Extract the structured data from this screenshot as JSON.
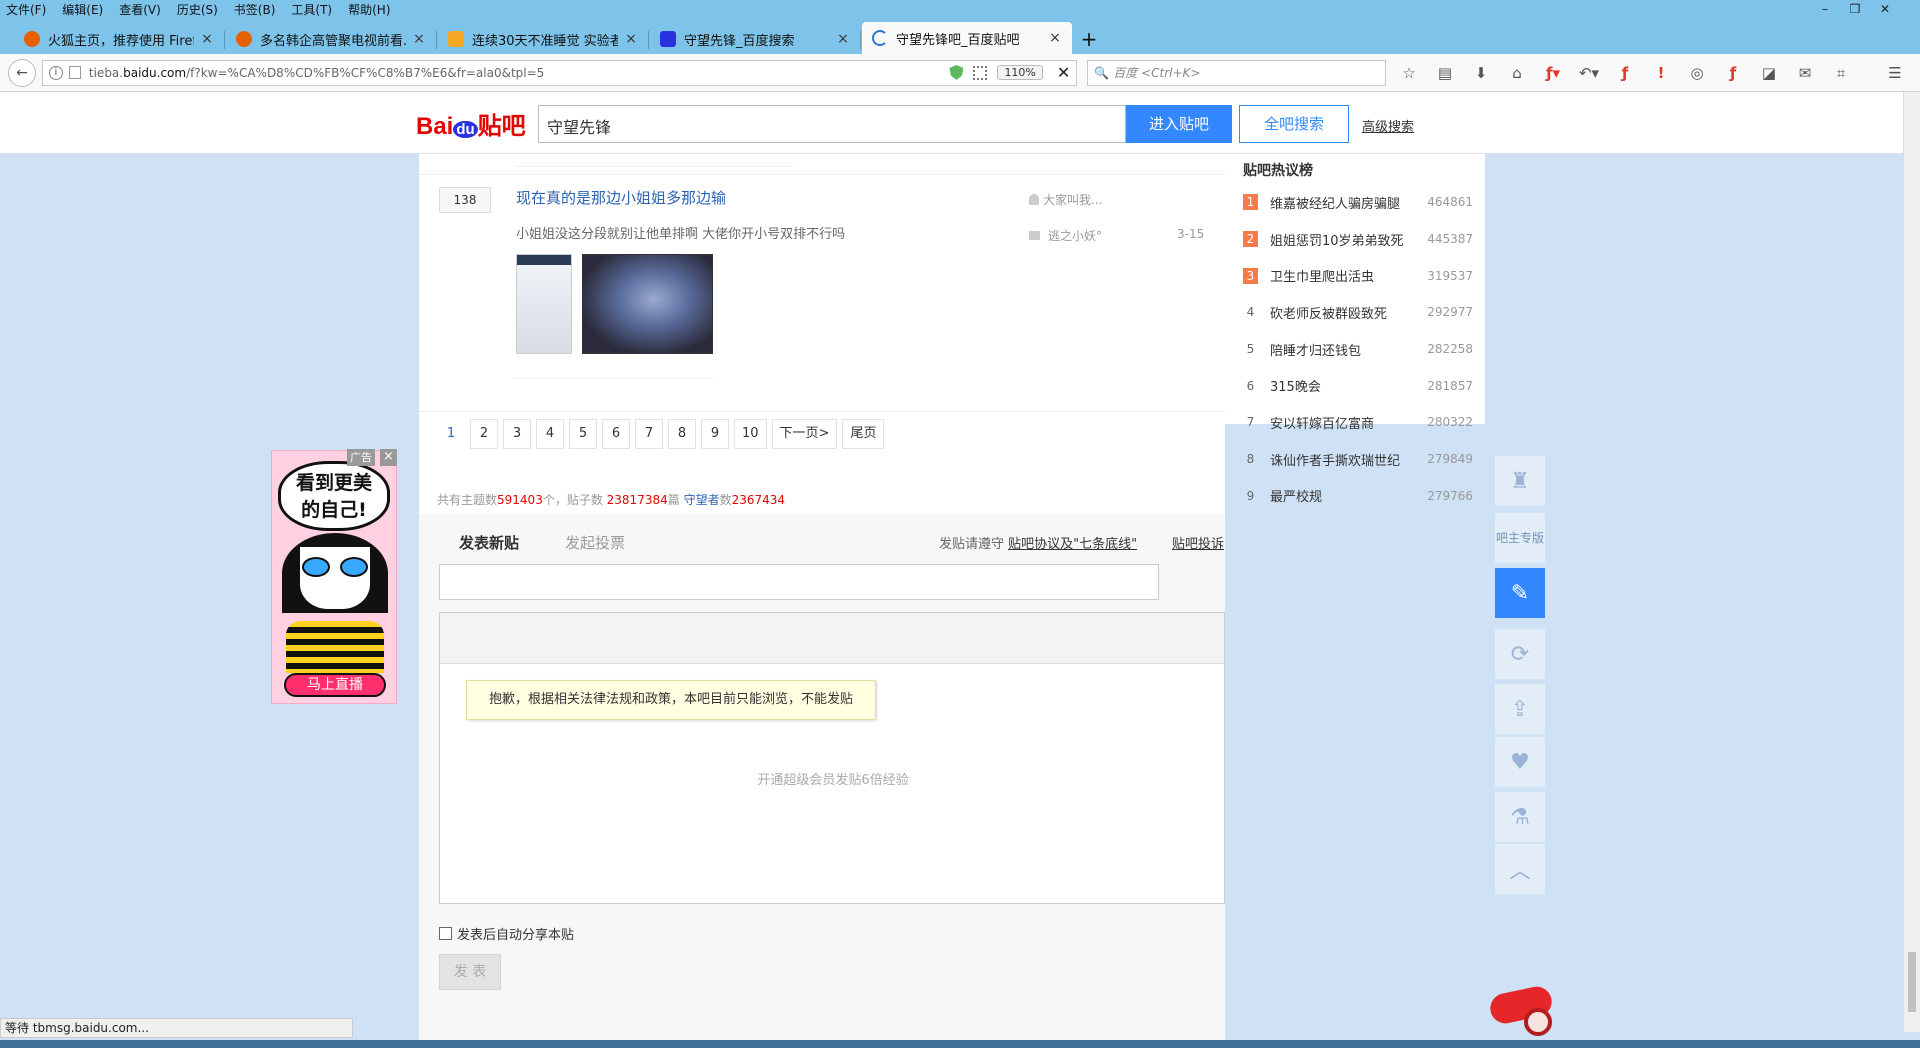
{
  "menubar": {
    "items": [
      "文件(F)",
      "编辑(E)",
      "查看(V)",
      "历史(S)",
      "书签(B)",
      "工具(T)",
      "帮助(H)"
    ]
  },
  "tabs": [
    {
      "title": "火狐主页，推荐使用 Firef...",
      "favicon_color": "#e66000",
      "active": false
    },
    {
      "title": "多名韩企高管聚电视前看...",
      "favicon_color": "#e66000",
      "active": false
    },
    {
      "title": "连续30天不准睡觉 实验者...",
      "favicon_color": "#f5a623",
      "active": false
    },
    {
      "title": "守望先锋_百度搜索",
      "favicon_color": "#2932e1",
      "active": false
    },
    {
      "title": "守望先锋吧_百度贴吧",
      "favicon_color": "#2b7bd4",
      "active": true
    }
  ],
  "navbar": {
    "url_prefix": "tieba.",
    "url_domain": "baidu.com",
    "url_rest": "/f?kw=%CA%D8%CD%FB%CF%C8%B7%E6&fr=ala0&tpl=5",
    "zoom": "110%",
    "search_placeholder": "百度 <Ctrl+K>"
  },
  "header": {
    "logo_bai": "Bai",
    "logo_du": "du",
    "logo_tieba": "贴吧",
    "search_value": "守望先锋",
    "enter_label": "进入贴吧",
    "allsearch_label": "全吧搜索",
    "advanced_label": "高级搜索"
  },
  "thread": {
    "reply_count": "138",
    "title": "现在真的是那边小姐姐多那边输",
    "excerpt": "小姐姐没这分段就别让他单排啊 大佬你开小号双排不行吗",
    "author": "大家叫我...",
    "last_replier": "逃之小妖°",
    "date": "3-15"
  },
  "pager": {
    "pages": [
      "1",
      "2",
      "3",
      "4",
      "5",
      "6",
      "7",
      "8",
      "9",
      "10"
    ],
    "next_label": "下一页>",
    "last_label": "尾页"
  },
  "stats": {
    "topics_label": "共有主题数",
    "topics": "591403",
    "topics_unit": "个，贴子数 ",
    "posts": "23817384",
    "posts_unit": "篇 ",
    "members_name": "守望者",
    "members_label": "数",
    "members": "2367434"
  },
  "post_area": {
    "tab_new": "发表新贴",
    "tab_vote": "发起投票",
    "notice_prefix": "发贴请遵守",
    "notice_link": "贴吧协议及\"七条底线\"",
    "complaint": "贴吧投诉",
    "ban_notice": "抱歉，根据相关法律法规和政策，本吧目前只能浏览，不能发贴",
    "svip_tip": "开通超级会员发贴6倍经验",
    "auto_share": "发表后自动分享本贴",
    "publish": "发 表"
  },
  "hot": {
    "title": "贴吧热议榜",
    "items": [
      {
        "rank": "1",
        "name": "维嘉被经纪人骗房骗腿",
        "count": "464861",
        "top": true
      },
      {
        "rank": "2",
        "name": "姐姐惩罚10岁弟弟致死",
        "count": "445387",
        "top": true
      },
      {
        "rank": "3",
        "name": "卫生巾里爬出活虫",
        "count": "319537",
        "top": true
      },
      {
        "rank": "4",
        "name": "砍老师反被群殴致死",
        "count": "292977",
        "top": false
      },
      {
        "rank": "5",
        "name": "陪睡才归还钱包",
        "count": "282258",
        "top": false
      },
      {
        "rank": "6",
        "name": "315晚会",
        "count": "281857",
        "top": false
      },
      {
        "rank": "7",
        "name": "安以轩嫁百亿富商",
        "count": "280322",
        "top": false
      },
      {
        "rank": "8",
        "name": "诛仙作者手撕欢瑞世纪",
        "count": "279849",
        "top": false
      },
      {
        "rank": "9",
        "name": "最严校规",
        "count": "279766",
        "top": false
      }
    ]
  },
  "ad": {
    "label": "广告",
    "close": "×",
    "bubble_line1": "看到更美",
    "bubble_line2": "的自己!",
    "button": "马上直播"
  },
  "float_bar": {
    "admin_line1": "吧主",
    "admin_line2": "专版"
  },
  "status": {
    "text": "等待 tbmsg.baidu.com..."
  }
}
